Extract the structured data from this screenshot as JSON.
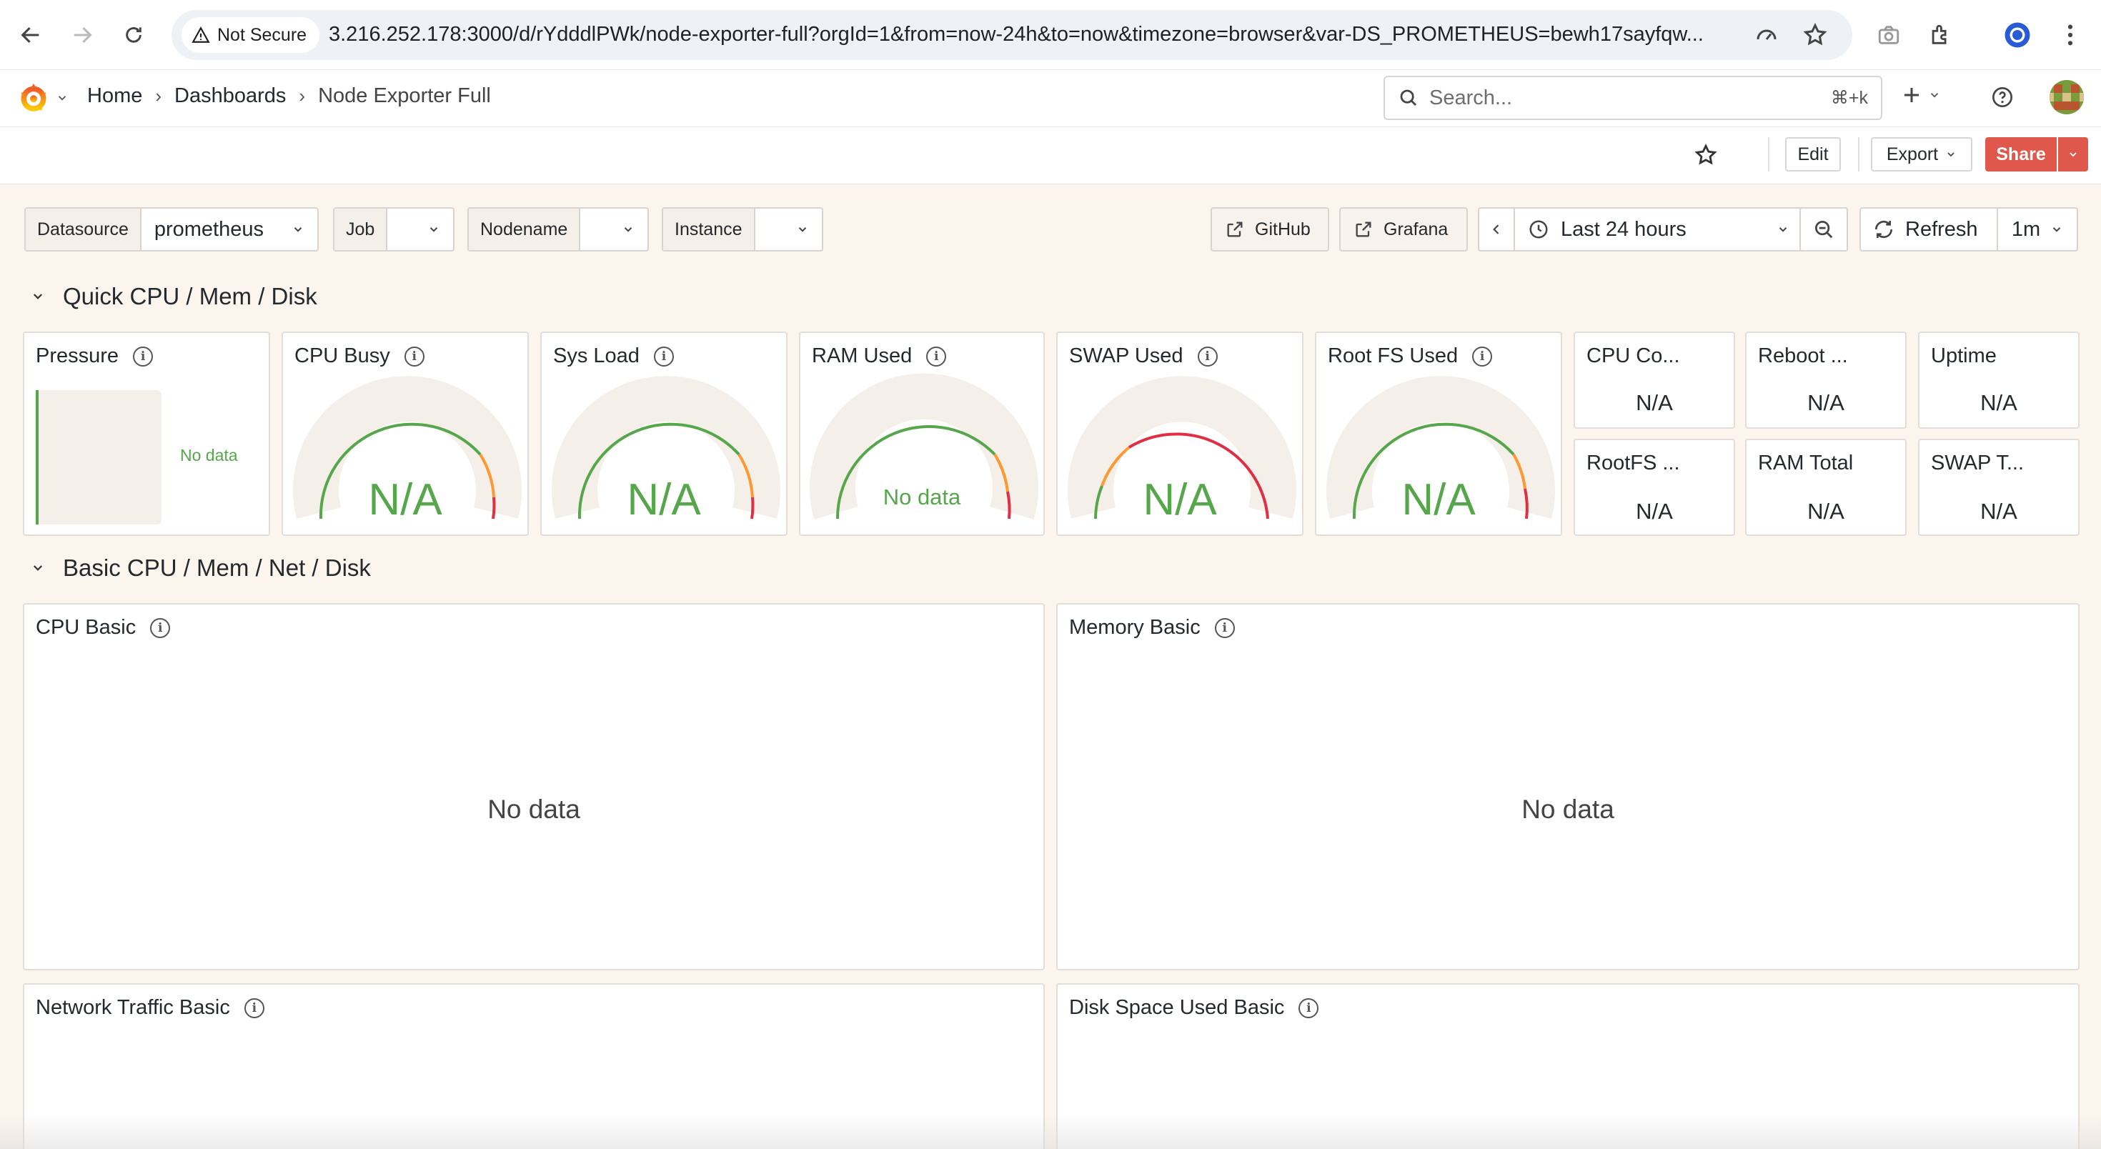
{
  "browser": {
    "secure_label": "Not Secure",
    "url": "3.216.252.178:3000/d/rYdddlPWk/node-exporter-full?orgId=1&from=now-24h&to=now&timezone=browser&var-DS_PROMETHEUS=bewh17sayfqw..."
  },
  "breadcrumb": {
    "home": "Home",
    "dashboards": "Dashboards",
    "current": "Node Exporter Full"
  },
  "search": {
    "placeholder": "Search...",
    "shortcut": "⌘+k"
  },
  "toolbar": {
    "edit_label": "Edit",
    "export_label": "Export",
    "share_label": "Share"
  },
  "variables": {
    "datasource_label": "Datasource",
    "datasource_value": "prometheus",
    "job_label": "Job",
    "job_value": "",
    "nodename_label": "Nodename",
    "nodename_value": "",
    "instance_label": "Instance",
    "instance_value": ""
  },
  "links": {
    "github": "GitHub",
    "grafana": "Grafana"
  },
  "time": {
    "range": "Last 24 hours",
    "refresh_label": "Refresh",
    "refresh_interval": "1m"
  },
  "rows": {
    "quick": "Quick CPU / Mem / Disk",
    "basic": "Basic CPU / Mem / Net / Disk"
  },
  "panels": {
    "pressure": {
      "title": "Pressure",
      "value": "No data"
    },
    "cpu_busy": {
      "title": "CPU Busy",
      "value": "N/A"
    },
    "sys_load": {
      "title": "Sys Load",
      "value": "N/A"
    },
    "ram_used": {
      "title": "RAM Used",
      "value": "No data"
    },
    "swap_used": {
      "title": "SWAP Used",
      "value": "N/A"
    },
    "root_fs_used": {
      "title": "Root FS Used",
      "value": "N/A"
    },
    "cpu_cores": {
      "title": "CPU Co...",
      "value": "N/A"
    },
    "reboot": {
      "title": "Reboot ...",
      "value": "N/A"
    },
    "uptime": {
      "title": "Uptime",
      "value": "N/A"
    },
    "rootfs_total": {
      "title": "RootFS ...",
      "value": "N/A"
    },
    "ram_total": {
      "title": "RAM Total",
      "value": "N/A"
    },
    "swap_total": {
      "title": "SWAP T...",
      "value": "N/A"
    },
    "cpu_basic": {
      "title": "CPU Basic",
      "value": "No data"
    },
    "memory_basic": {
      "title": "Memory Basic",
      "value": "No data"
    },
    "network_basic": {
      "title": "Network Traffic Basic"
    },
    "disk_basic": {
      "title": "Disk Space Used Basic"
    }
  },
  "colors": {
    "accent_share": "#e0584c",
    "gauge_green": "#56a64b",
    "gauge_red": "#e02f44",
    "gauge_orange": "#ff9830",
    "dashboard_bg": "#fcf5ee"
  }
}
